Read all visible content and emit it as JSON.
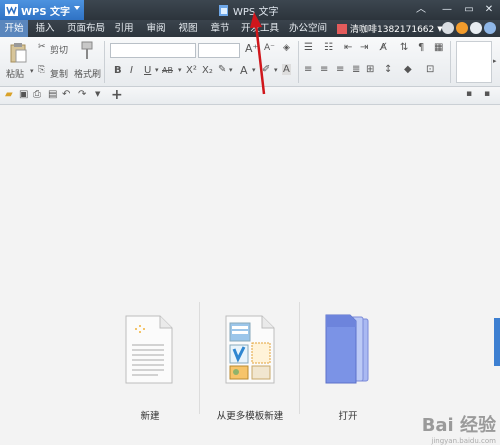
{
  "app": {
    "name": "WPS 文字",
    "window_title": "WPS 文字"
  },
  "menu": {
    "items": [
      {
        "label": "开始",
        "active": true
      },
      {
        "label": "插入"
      },
      {
        "label": "页面布局"
      },
      {
        "label": "引用"
      },
      {
        "label": "审阅"
      },
      {
        "label": "视图"
      },
      {
        "label": "章节"
      },
      {
        "label": "开发工具"
      },
      {
        "label": "办公空间"
      }
    ]
  },
  "user": {
    "name": "清咖啡1382171662"
  },
  "ribbon": {
    "paste": "粘贴",
    "cut": "剪切",
    "copy": "复制",
    "format_painter": "格式刷"
  },
  "start": {
    "new_label": "新建",
    "template_label": "从更多模板新建",
    "open_label": "打开"
  },
  "watermark": {
    "text": "Bai 经验",
    "sub": "jingyan.baidu.com"
  },
  "colors": {
    "accent": "#3c7fd3",
    "titlebar": "#333b43",
    "arrow": "#d0161b"
  }
}
